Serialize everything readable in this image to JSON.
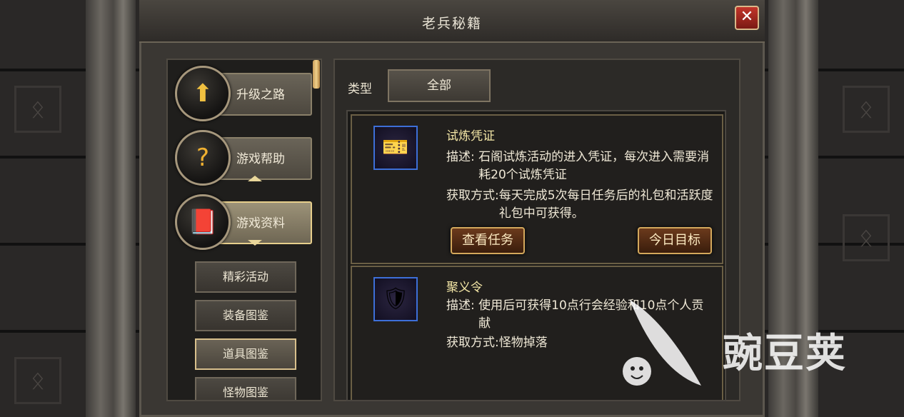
{
  "window": {
    "title": "老兵秘籍",
    "close": "✕"
  },
  "categories": [
    {
      "label": "升级之路",
      "icon": "⬆",
      "icon_name": "level-up-scroll-icon"
    },
    {
      "label": "游戏帮助",
      "icon": "?",
      "icon_name": "help-book-icon"
    },
    {
      "label": "游戏资料",
      "icon": "📕",
      "icon_name": "data-book-icon"
    }
  ],
  "subcategories": [
    "精彩活动",
    "装备图鉴",
    "道具图鉴",
    "怪物图鉴"
  ],
  "filter": {
    "label": "类型",
    "value": "全部"
  },
  "items": [
    {
      "name": "试炼凭证",
      "icon": "🎫",
      "desc_label": "描述:",
      "desc": "石阁试炼活动的进入凭证，每次进入需要消耗20个试炼凭证",
      "src_label": "获取方式:",
      "src": "每天完成5次每日任务后的礼包和活跃度礼包中可获得。",
      "buttons": [
        "查看任务",
        "今日目标"
      ]
    },
    {
      "name": "聚义令",
      "icon": "🛡",
      "desc_label": "描述:",
      "desc": "使用后可获得10点行会经验和10点个人贡献",
      "src_label": "获取方式:",
      "src": "怪物掉落"
    }
  ],
  "watermark": {
    "text": "豌豆荚"
  }
}
